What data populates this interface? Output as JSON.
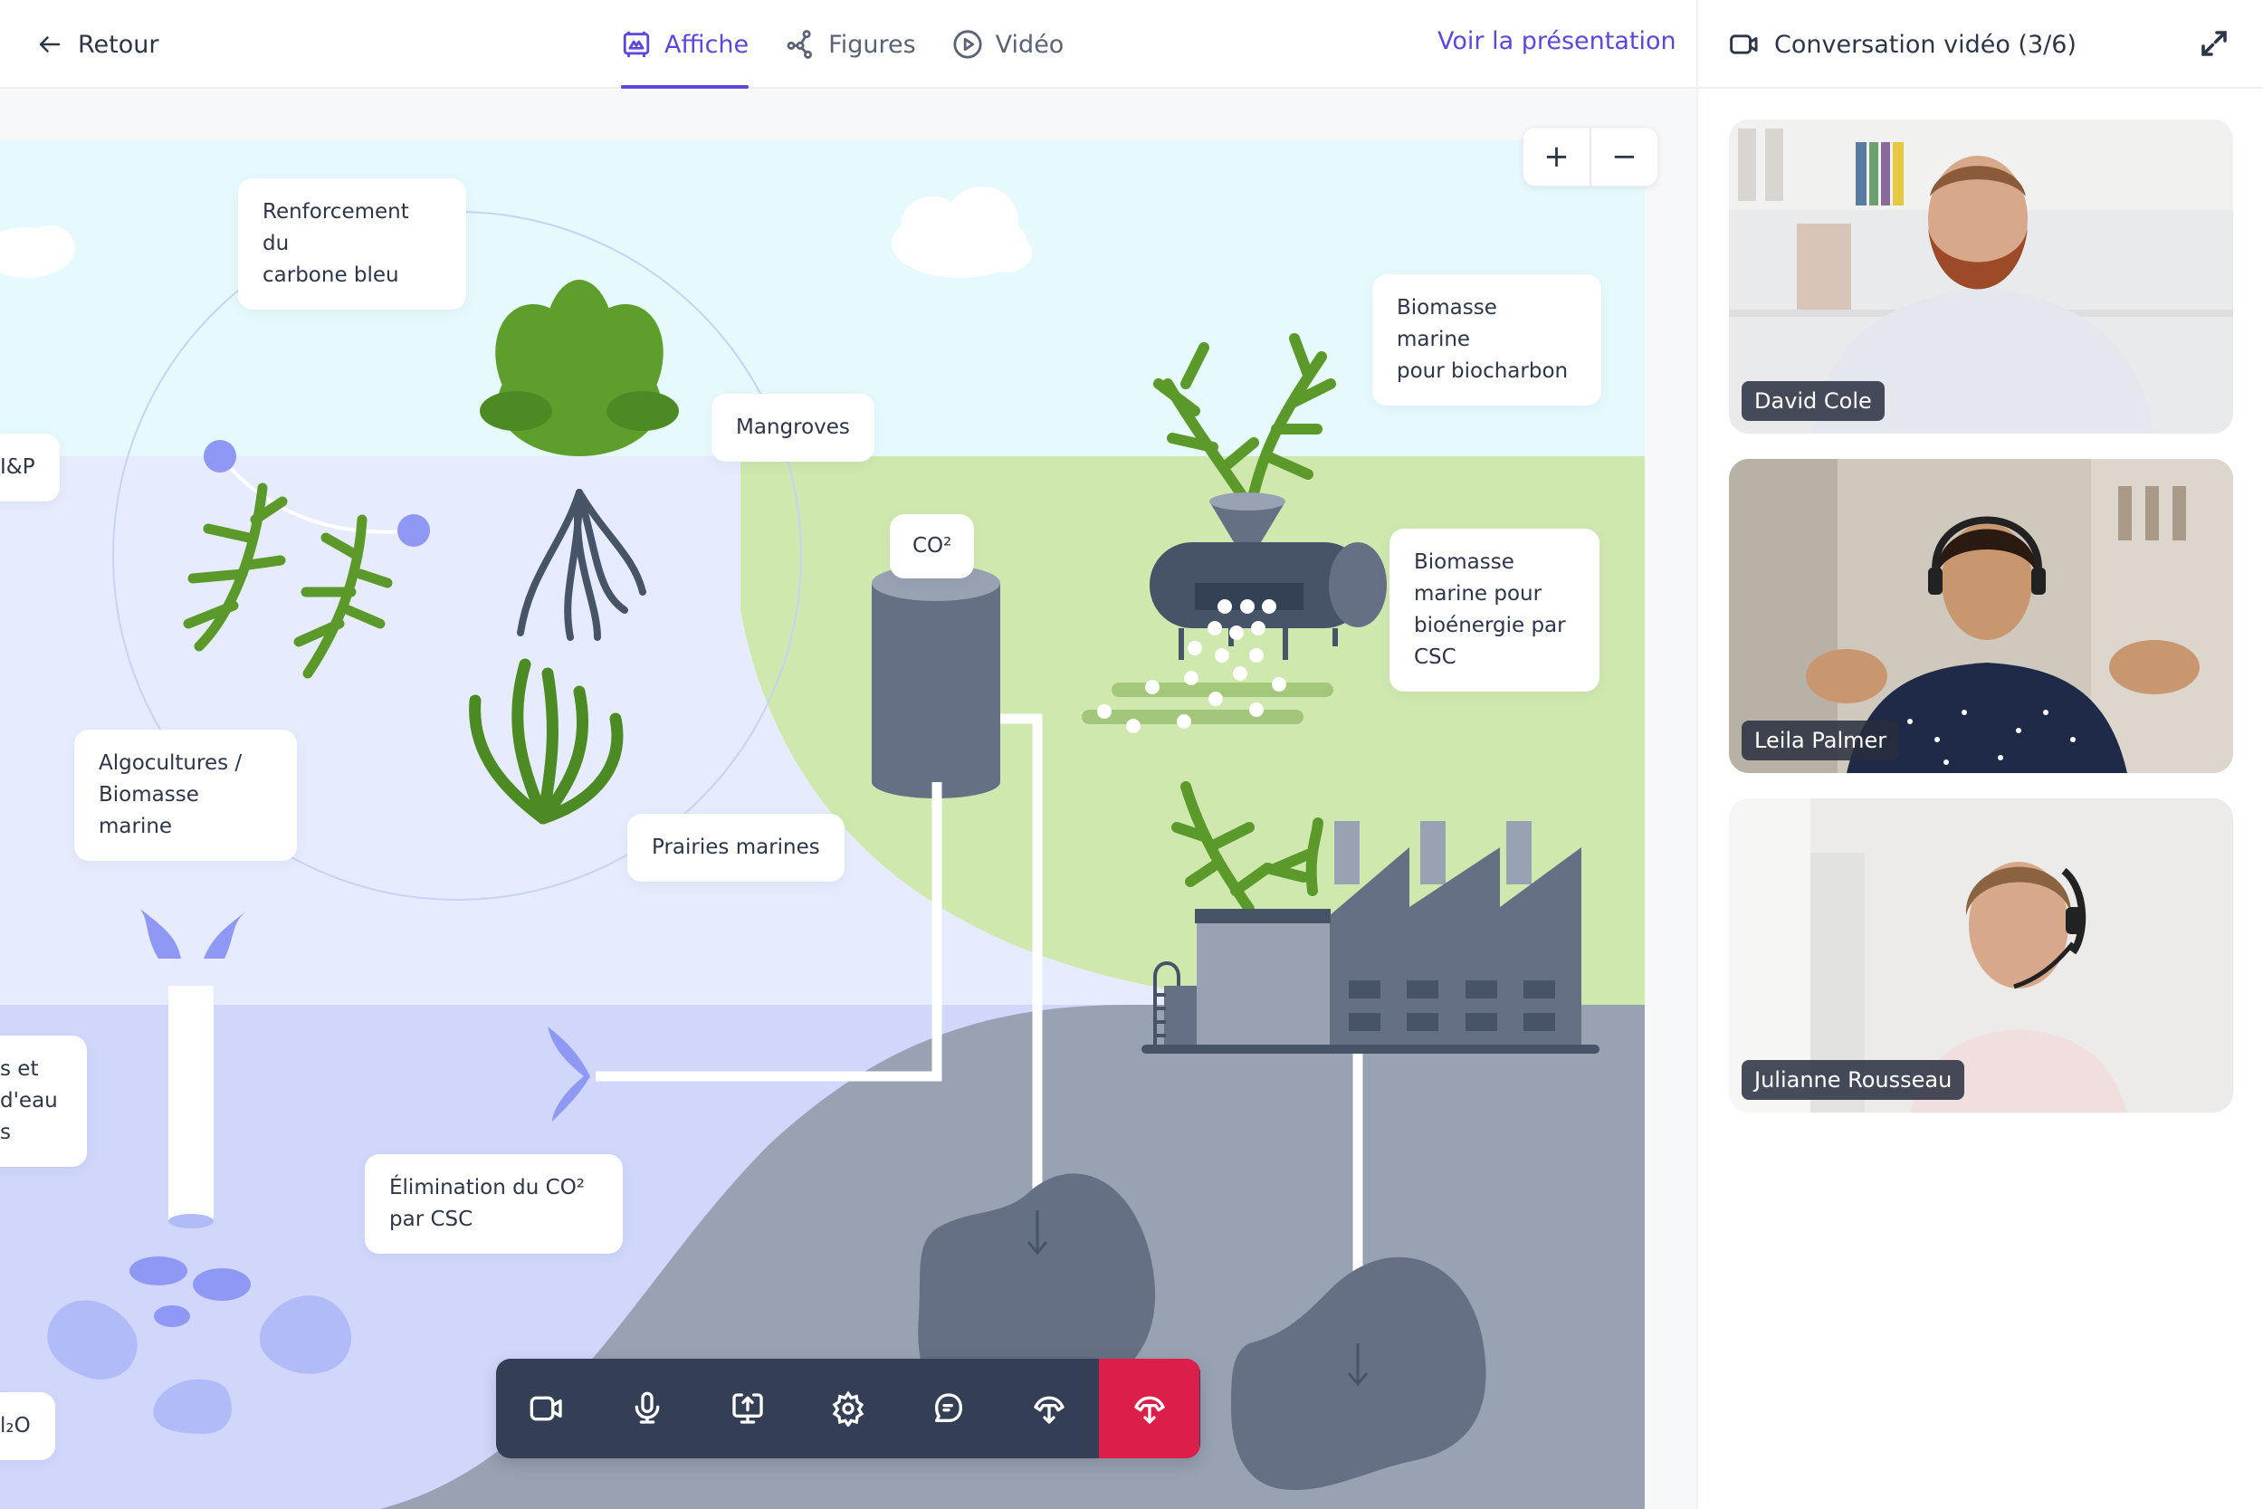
{
  "header": {
    "back_label": "Retour",
    "tabs": [
      {
        "label": "Affiche",
        "icon": "poster-icon",
        "active": true
      },
      {
        "label": "Figures",
        "icon": "graph-nodes-icon",
        "active": false
      },
      {
        "label": "Vidéo",
        "icon": "play-circle-icon",
        "active": false
      }
    ],
    "present_link": "Voir la présentation",
    "conversation_title": "Conversation vidéo (3/6)"
  },
  "poster": {
    "labels": {
      "blue_carbon": "Renforcement du\ncarbone bleu",
      "mangroves": "Mangroves",
      "biochar": "Biomasse marine\npour biocharbon",
      "co2_tank": "CO²",
      "bioenergy": "Biomasse\nmarine pour\nbioénergie par\nCSC",
      "left_ip": "I&P",
      "algaculture": "Algocultures /\nBiomasse marine",
      "seagrass": "Prairies marines",
      "left_water": "s et\n d'eau\ns",
      "co2_removal": "Élimination du CO²\npar CSC",
      "left_h2o": "l₂O"
    },
    "colors": {
      "sky": "#e6fafd",
      "shallow_sea": "#e6ecfd",
      "deep_sea": "#d0d7fb",
      "land": "#cfe8ae",
      "seabed": "#98a2b3",
      "reservoir": "#667085",
      "machine": "#475467"
    }
  },
  "zoom_controls": {
    "zoom_in": "+",
    "zoom_out": "−"
  },
  "toolbar": {
    "buttons": [
      {
        "name": "camera",
        "icon": "video-camera-icon"
      },
      {
        "name": "microphone",
        "icon": "microphone-icon"
      },
      {
        "name": "share-screen",
        "icon": "screen-share-icon"
      },
      {
        "name": "settings",
        "icon": "gear-icon"
      },
      {
        "name": "chat",
        "icon": "chat-bubble-icon"
      },
      {
        "name": "hang-up-secondary",
        "icon": "phone-down-icon"
      },
      {
        "name": "end-call",
        "icon": "phone-end-icon"
      }
    ],
    "end_call_color": "#dc1f4a"
  },
  "participants": [
    {
      "name": "David Cole"
    },
    {
      "name": "Leila Palmer"
    },
    {
      "name": "Julianne Rousseau"
    }
  ],
  "accent_color": "#5b47dc"
}
